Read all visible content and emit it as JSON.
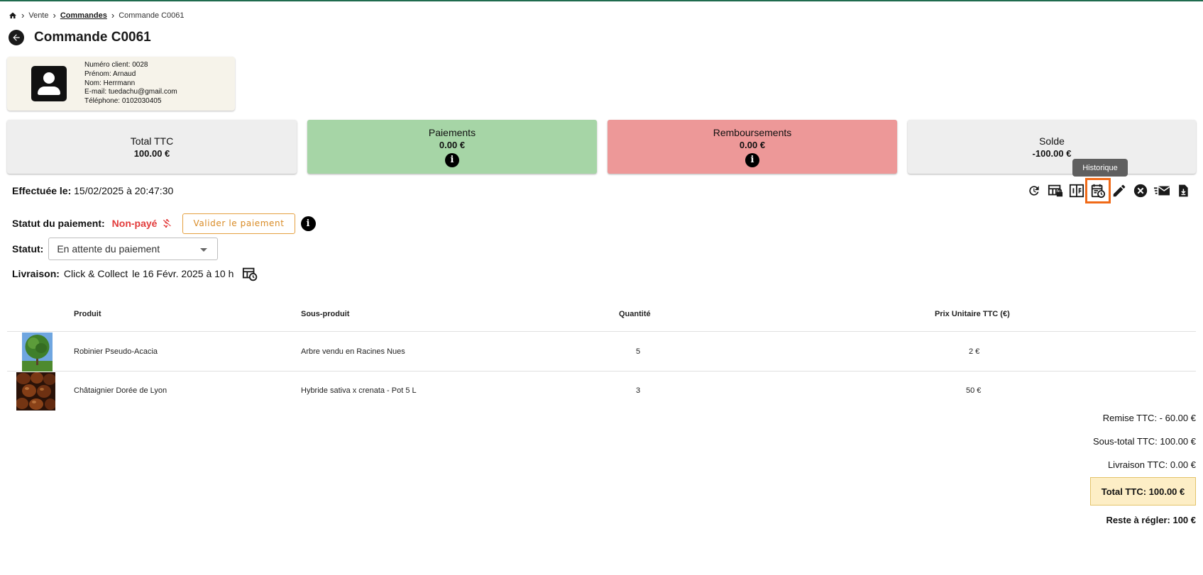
{
  "breadcrumb": {
    "items": [
      "Vente",
      "Commandes",
      "Commande C0061"
    ]
  },
  "page": {
    "title": "Commande C0061"
  },
  "client": {
    "numero": "Numéro client: 0028",
    "prenom": "Prénom: Arnaud",
    "nom": "Nom: Herrmann",
    "email": "E-mail: tuedachu@gmail.com",
    "telephone": "Téléphone: 0102030405"
  },
  "summary": {
    "total_label": "Total TTC",
    "total_value": "100.00 €",
    "paiements_label": "Paiements",
    "paiements_value": "0.00 €",
    "remboursements_label": "Remboursements",
    "remboursements_value": "0.00 €",
    "solde_label": "Solde",
    "solde_value": "-100.00 €",
    "info_glyph": "i"
  },
  "tooltip": "Historique",
  "effectuee": {
    "label": "Effectuée le:",
    "value": "15/02/2025 à 20:47:30"
  },
  "toolbar": {
    "icons": [
      "refresh-icon",
      "table-lock-icon",
      "invoice-number-icon",
      "calendar-history-icon",
      "edit-icon",
      "cancel-icon",
      "email-icon",
      "download-icon"
    ],
    "highlighted": "calendar-history-icon"
  },
  "payment": {
    "label": "Statut du paiement:",
    "status": "Non-payé",
    "validate_button": "Valider le paiement",
    "info_glyph": "i"
  },
  "statut": {
    "label": "Statut:",
    "selected": "En attente du paiement"
  },
  "livraison": {
    "label": "Livraison:",
    "mode": "Click & Collect",
    "date": "le 16 Févr. 2025 à 10 h"
  },
  "table": {
    "headers": {
      "produit": "Produit",
      "sous_produit": "Sous-produit",
      "quantite": "Quantité",
      "prix": "Prix Unitaire TTC (€)"
    },
    "rows": [
      {
        "produit": "Robinier Pseudo-Acacia",
        "sous_produit": "Arbre vendu en Racines Nues",
        "quantite": "5",
        "prix": "2 €",
        "image": "tree-photo"
      },
      {
        "produit": "Châtaignier Dorée de Lyon",
        "sous_produit": "Hybride sativa x crenata - Pot 5 L",
        "quantite": "3",
        "prix": "50 €",
        "image": "chestnuts-photo"
      }
    ]
  },
  "totals": {
    "remise": "Remise TTC: - 60.00 €",
    "sous_total": "Sous-total TTC: 100.00 €",
    "livraison": "Livraison TTC: 0.00 €",
    "total": "Total TTC: 100.00 €",
    "reste": "Reste à régler: 100 €"
  },
  "colors": {
    "accent_green": "#1f6b4e",
    "paiements_bg": "#a6d5a6",
    "remboursements_bg": "#ed9898",
    "unpaid_red": "#e23b3b",
    "validate_orange": "#d98b25",
    "highlight_orange": "#f06a18",
    "total_box_bg": "#fdeec6"
  }
}
